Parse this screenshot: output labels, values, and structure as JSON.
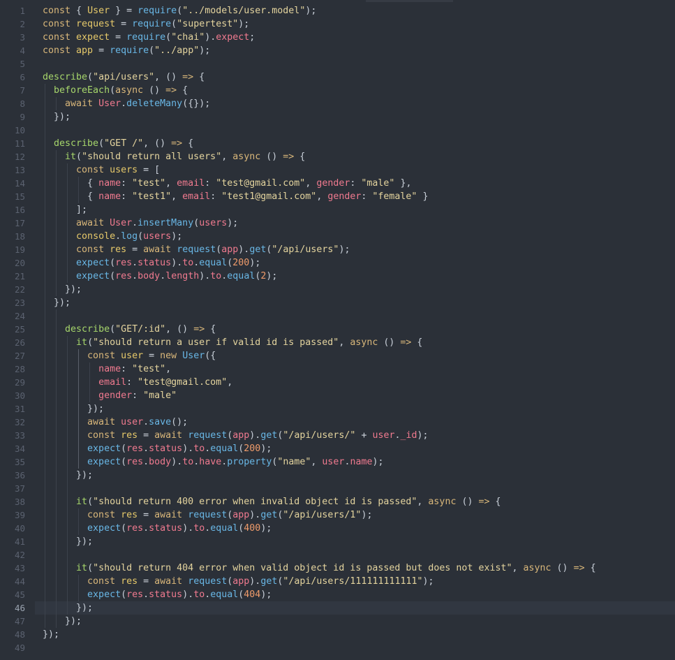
{
  "editor": {
    "active_line": 46,
    "line_numbers": [
      "1",
      "2",
      "3",
      "4",
      "5",
      "6",
      "7",
      "8",
      "9",
      "10",
      "11",
      "12",
      "13",
      "14",
      "15",
      "16",
      "17",
      "18",
      "19",
      "20",
      "21",
      "22",
      "23",
      "24",
      "25",
      "26",
      "27",
      "28",
      "29",
      "30",
      "31",
      "32",
      "33",
      "34",
      "35",
      "36",
      "37",
      "38",
      "39",
      "40",
      "41",
      "42",
      "43",
      "44",
      "45",
      "46",
      "47",
      "48",
      "49"
    ],
    "lines": [
      [
        [
          "kw",
          "const "
        ],
        [
          "punc",
          "{ "
        ],
        [
          "var",
          "User"
        ],
        [
          "punc",
          " } "
        ],
        [
          "op",
          "= "
        ],
        [
          "meth",
          "require"
        ],
        [
          "punc",
          "("
        ],
        [
          "str",
          "\"../models/user.model\""
        ],
        [
          "punc",
          ");"
        ]
      ],
      [
        [
          "kw",
          "const "
        ],
        [
          "var",
          "request"
        ],
        [
          "op",
          " = "
        ],
        [
          "meth",
          "require"
        ],
        [
          "punc",
          "("
        ],
        [
          "str",
          "\"supertest\""
        ],
        [
          "punc",
          ");"
        ]
      ],
      [
        [
          "kw",
          "const "
        ],
        [
          "var",
          "expect"
        ],
        [
          "op",
          " = "
        ],
        [
          "meth",
          "require"
        ],
        [
          "punc",
          "("
        ],
        [
          "str",
          "\"chai\""
        ],
        [
          "punc",
          ")."
        ],
        [
          "prop",
          "expect"
        ],
        [
          "punc",
          ";"
        ]
      ],
      [
        [
          "kw",
          "const "
        ],
        [
          "var",
          "app"
        ],
        [
          "op",
          " = "
        ],
        [
          "meth",
          "require"
        ],
        [
          "punc",
          "("
        ],
        [
          "str",
          "\"../app\""
        ],
        [
          "punc",
          ");"
        ]
      ],
      [],
      [
        [
          "fn",
          "describe"
        ],
        [
          "punc",
          "("
        ],
        [
          "str",
          "\"api/users\""
        ],
        [
          "punc",
          ", () "
        ],
        [
          "kw",
          "=>"
        ],
        [
          "punc",
          " {"
        ]
      ],
      [
        [
          "punc",
          "  "
        ],
        [
          "fn",
          "beforeEach"
        ],
        [
          "punc",
          "("
        ],
        [
          "kw",
          "async"
        ],
        [
          "punc",
          " () "
        ],
        [
          "kw",
          "=>"
        ],
        [
          "punc",
          " {"
        ]
      ],
      [
        [
          "punc",
          "    "
        ],
        [
          "kw",
          "await "
        ],
        [
          "prop",
          "User"
        ],
        [
          "punc",
          "."
        ],
        [
          "meth",
          "deleteMany"
        ],
        [
          "punc",
          "({});"
        ]
      ],
      [
        [
          "punc",
          "  });"
        ]
      ],
      [],
      [
        [
          "punc",
          "  "
        ],
        [
          "fn",
          "describe"
        ],
        [
          "punc",
          "("
        ],
        [
          "str",
          "\"GET /\""
        ],
        [
          "punc",
          ", () "
        ],
        [
          "kw",
          "=>"
        ],
        [
          "punc",
          " {"
        ]
      ],
      [
        [
          "punc",
          "    "
        ],
        [
          "fn",
          "it"
        ],
        [
          "punc",
          "("
        ],
        [
          "str",
          "\"should return all users\""
        ],
        [
          "punc",
          ", "
        ],
        [
          "kw",
          "async"
        ],
        [
          "punc",
          " () "
        ],
        [
          "kw",
          "=>"
        ],
        [
          "punc",
          " {"
        ]
      ],
      [
        [
          "punc",
          "      "
        ],
        [
          "kw",
          "const "
        ],
        [
          "var",
          "users"
        ],
        [
          "op",
          " = "
        ],
        [
          "punc",
          "["
        ]
      ],
      [
        [
          "punc",
          "        { "
        ],
        [
          "prop",
          "name"
        ],
        [
          "punc",
          ": "
        ],
        [
          "str",
          "\"test\""
        ],
        [
          "punc",
          ", "
        ],
        [
          "prop",
          "email"
        ],
        [
          "punc",
          ": "
        ],
        [
          "str",
          "\"test@gmail.com\""
        ],
        [
          "punc",
          ", "
        ],
        [
          "prop",
          "gender"
        ],
        [
          "punc",
          ": "
        ],
        [
          "str",
          "\"male\""
        ],
        [
          "punc",
          " },"
        ]
      ],
      [
        [
          "punc",
          "        { "
        ],
        [
          "prop",
          "name"
        ],
        [
          "punc",
          ": "
        ],
        [
          "str",
          "\"test1\""
        ],
        [
          "punc",
          ", "
        ],
        [
          "prop",
          "email"
        ],
        [
          "punc",
          ": "
        ],
        [
          "str",
          "\"test1@gmail.com\""
        ],
        [
          "punc",
          ", "
        ],
        [
          "prop",
          "gender"
        ],
        [
          "punc",
          ": "
        ],
        [
          "str",
          "\"female\""
        ],
        [
          "punc",
          " }"
        ]
      ],
      [
        [
          "punc",
          "      ];"
        ]
      ],
      [
        [
          "punc",
          "      "
        ],
        [
          "kw",
          "await "
        ],
        [
          "prop",
          "User"
        ],
        [
          "punc",
          "."
        ],
        [
          "meth",
          "insertMany"
        ],
        [
          "punc",
          "("
        ],
        [
          "prop",
          "users"
        ],
        [
          "punc",
          ");"
        ]
      ],
      [
        [
          "punc",
          "      "
        ],
        [
          "var",
          "console"
        ],
        [
          "punc",
          "."
        ],
        [
          "meth",
          "log"
        ],
        [
          "punc",
          "("
        ],
        [
          "prop",
          "users"
        ],
        [
          "punc",
          ");"
        ]
      ],
      [
        [
          "punc",
          "      "
        ],
        [
          "kw",
          "const "
        ],
        [
          "var",
          "res"
        ],
        [
          "op",
          " = "
        ],
        [
          "kw",
          "await "
        ],
        [
          "meth",
          "request"
        ],
        [
          "punc",
          "("
        ],
        [
          "prop",
          "app"
        ],
        [
          "punc",
          ")."
        ],
        [
          "meth",
          "get"
        ],
        [
          "punc",
          "("
        ],
        [
          "str",
          "\"/api/users\""
        ],
        [
          "punc",
          ");"
        ]
      ],
      [
        [
          "punc",
          "      "
        ],
        [
          "meth",
          "expect"
        ],
        [
          "punc",
          "("
        ],
        [
          "prop",
          "res"
        ],
        [
          "punc",
          "."
        ],
        [
          "prop",
          "status"
        ],
        [
          "punc",
          ")."
        ],
        [
          "prop",
          "to"
        ],
        [
          "punc",
          "."
        ],
        [
          "meth",
          "equal"
        ],
        [
          "punc",
          "("
        ],
        [
          "num",
          "200"
        ],
        [
          "punc",
          ");"
        ]
      ],
      [
        [
          "punc",
          "      "
        ],
        [
          "meth",
          "expect"
        ],
        [
          "punc",
          "("
        ],
        [
          "prop",
          "res"
        ],
        [
          "punc",
          "."
        ],
        [
          "prop",
          "body"
        ],
        [
          "punc",
          "."
        ],
        [
          "prop",
          "length"
        ],
        [
          "punc",
          ")."
        ],
        [
          "prop",
          "to"
        ],
        [
          "punc",
          "."
        ],
        [
          "meth",
          "equal"
        ],
        [
          "punc",
          "("
        ],
        [
          "num",
          "2"
        ],
        [
          "punc",
          ");"
        ]
      ],
      [
        [
          "punc",
          "    });"
        ]
      ],
      [
        [
          "punc",
          "  });"
        ]
      ],
      [],
      [
        [
          "punc",
          "    "
        ],
        [
          "fn",
          "describe"
        ],
        [
          "punc",
          "("
        ],
        [
          "str",
          "\"GET/:id\""
        ],
        [
          "punc",
          ", () "
        ],
        [
          "kw",
          "=>"
        ],
        [
          "punc",
          " {"
        ]
      ],
      [
        [
          "punc",
          "      "
        ],
        [
          "fn",
          "it"
        ],
        [
          "punc",
          "("
        ],
        [
          "str",
          "\"should return a user if valid id is passed\""
        ],
        [
          "punc",
          ", "
        ],
        [
          "kw",
          "async"
        ],
        [
          "punc",
          " () "
        ],
        [
          "kw",
          "=>"
        ],
        [
          "punc",
          " {"
        ]
      ],
      [
        [
          "punc",
          "        "
        ],
        [
          "kw",
          "const "
        ],
        [
          "var",
          "user"
        ],
        [
          "op",
          " = "
        ],
        [
          "kw",
          "new "
        ],
        [
          "meth",
          "User"
        ],
        [
          "punc",
          "({"
        ]
      ],
      [
        [
          "punc",
          "          "
        ],
        [
          "prop",
          "name"
        ],
        [
          "punc",
          ": "
        ],
        [
          "str",
          "\"test\""
        ],
        [
          "punc",
          ","
        ]
      ],
      [
        [
          "punc",
          "          "
        ],
        [
          "prop",
          "email"
        ],
        [
          "punc",
          ": "
        ],
        [
          "str",
          "\"test@gmail.com\""
        ],
        [
          "punc",
          ","
        ]
      ],
      [
        [
          "punc",
          "          "
        ],
        [
          "prop",
          "gender"
        ],
        [
          "punc",
          ": "
        ],
        [
          "str",
          "\"male\""
        ]
      ],
      [
        [
          "punc",
          "        });"
        ]
      ],
      [
        [
          "punc",
          "        "
        ],
        [
          "kw",
          "await "
        ],
        [
          "prop",
          "user"
        ],
        [
          "punc",
          "."
        ],
        [
          "meth",
          "save"
        ],
        [
          "punc",
          "();"
        ]
      ],
      [
        [
          "punc",
          "        "
        ],
        [
          "kw",
          "const "
        ],
        [
          "var",
          "res"
        ],
        [
          "op",
          " = "
        ],
        [
          "kw",
          "await "
        ],
        [
          "meth",
          "request"
        ],
        [
          "punc",
          "("
        ],
        [
          "prop",
          "app"
        ],
        [
          "punc",
          ")."
        ],
        [
          "meth",
          "get"
        ],
        [
          "punc",
          "("
        ],
        [
          "str",
          "\"/api/users/\""
        ],
        [
          "op",
          " + "
        ],
        [
          "prop",
          "user"
        ],
        [
          "punc",
          "."
        ],
        [
          "prop",
          "_id"
        ],
        [
          "punc",
          ");"
        ]
      ],
      [
        [
          "punc",
          "        "
        ],
        [
          "meth",
          "expect"
        ],
        [
          "punc",
          "("
        ],
        [
          "prop",
          "res"
        ],
        [
          "punc",
          "."
        ],
        [
          "prop",
          "status"
        ],
        [
          "punc",
          ")."
        ],
        [
          "prop",
          "to"
        ],
        [
          "punc",
          "."
        ],
        [
          "meth",
          "equal"
        ],
        [
          "punc",
          "("
        ],
        [
          "num",
          "200"
        ],
        [
          "punc",
          ");"
        ]
      ],
      [
        [
          "punc",
          "        "
        ],
        [
          "meth",
          "expect"
        ],
        [
          "punc",
          "("
        ],
        [
          "prop",
          "res"
        ],
        [
          "punc",
          "."
        ],
        [
          "prop",
          "body"
        ],
        [
          "punc",
          ")."
        ],
        [
          "prop",
          "to"
        ],
        [
          "punc",
          "."
        ],
        [
          "prop",
          "have"
        ],
        [
          "punc",
          "."
        ],
        [
          "meth",
          "property"
        ],
        [
          "punc",
          "("
        ],
        [
          "str",
          "\"name\""
        ],
        [
          "punc",
          ", "
        ],
        [
          "prop",
          "user"
        ],
        [
          "punc",
          "."
        ],
        [
          "prop",
          "name"
        ],
        [
          "punc",
          ");"
        ]
      ],
      [
        [
          "punc",
          "      });"
        ]
      ],
      [],
      [
        [
          "punc",
          "      "
        ],
        [
          "fn",
          "it"
        ],
        [
          "punc",
          "("
        ],
        [
          "str",
          "\"should return 400 error when invalid object id is passed\""
        ],
        [
          "punc",
          ", "
        ],
        [
          "kw",
          "async"
        ],
        [
          "punc",
          " () "
        ],
        [
          "kw",
          "=>"
        ],
        [
          "punc",
          " {"
        ]
      ],
      [
        [
          "punc",
          "        "
        ],
        [
          "kw",
          "const "
        ],
        [
          "var",
          "res"
        ],
        [
          "op",
          " = "
        ],
        [
          "kw",
          "await "
        ],
        [
          "meth",
          "request"
        ],
        [
          "punc",
          "("
        ],
        [
          "prop",
          "app"
        ],
        [
          "punc",
          ")."
        ],
        [
          "meth",
          "get"
        ],
        [
          "punc",
          "("
        ],
        [
          "str",
          "\"/api/users/1\""
        ],
        [
          "punc",
          ");"
        ]
      ],
      [
        [
          "punc",
          "        "
        ],
        [
          "meth",
          "expect"
        ],
        [
          "punc",
          "("
        ],
        [
          "prop",
          "res"
        ],
        [
          "punc",
          "."
        ],
        [
          "prop",
          "status"
        ],
        [
          "punc",
          ")."
        ],
        [
          "prop",
          "to"
        ],
        [
          "punc",
          "."
        ],
        [
          "meth",
          "equal"
        ],
        [
          "punc",
          "("
        ],
        [
          "num",
          "400"
        ],
        [
          "punc",
          ");"
        ]
      ],
      [
        [
          "punc",
          "      });"
        ]
      ],
      [],
      [
        [
          "punc",
          "      "
        ],
        [
          "fn",
          "it"
        ],
        [
          "punc",
          "("
        ],
        [
          "str",
          "\"should return 404 error when valid object id is passed but does not exist\""
        ],
        [
          "punc",
          ", "
        ],
        [
          "kw",
          "async"
        ],
        [
          "punc",
          " () "
        ],
        [
          "kw",
          "=>"
        ],
        [
          "punc",
          " {"
        ]
      ],
      [
        [
          "punc",
          "        "
        ],
        [
          "kw",
          "const "
        ],
        [
          "var",
          "res"
        ],
        [
          "op",
          " = "
        ],
        [
          "kw",
          "await "
        ],
        [
          "meth",
          "request"
        ],
        [
          "punc",
          "("
        ],
        [
          "prop",
          "app"
        ],
        [
          "punc",
          ")."
        ],
        [
          "meth",
          "get"
        ],
        [
          "punc",
          "("
        ],
        [
          "str",
          "\"/api/users/111111111111\""
        ],
        [
          "punc",
          ");"
        ]
      ],
      [
        [
          "punc",
          "        "
        ],
        [
          "meth",
          "expect"
        ],
        [
          "punc",
          "("
        ],
        [
          "prop",
          "res"
        ],
        [
          "punc",
          "."
        ],
        [
          "prop",
          "status"
        ],
        [
          "punc",
          ")."
        ],
        [
          "prop",
          "to"
        ],
        [
          "punc",
          "."
        ],
        [
          "meth",
          "equal"
        ],
        [
          "punc",
          "("
        ],
        [
          "num",
          "404"
        ],
        [
          "punc",
          ");"
        ]
      ],
      [
        [
          "punc",
          "      });"
        ]
      ],
      [
        [
          "punc",
          "    });"
        ]
      ],
      [
        [
          "punc",
          "});"
        ]
      ],
      []
    ]
  }
}
